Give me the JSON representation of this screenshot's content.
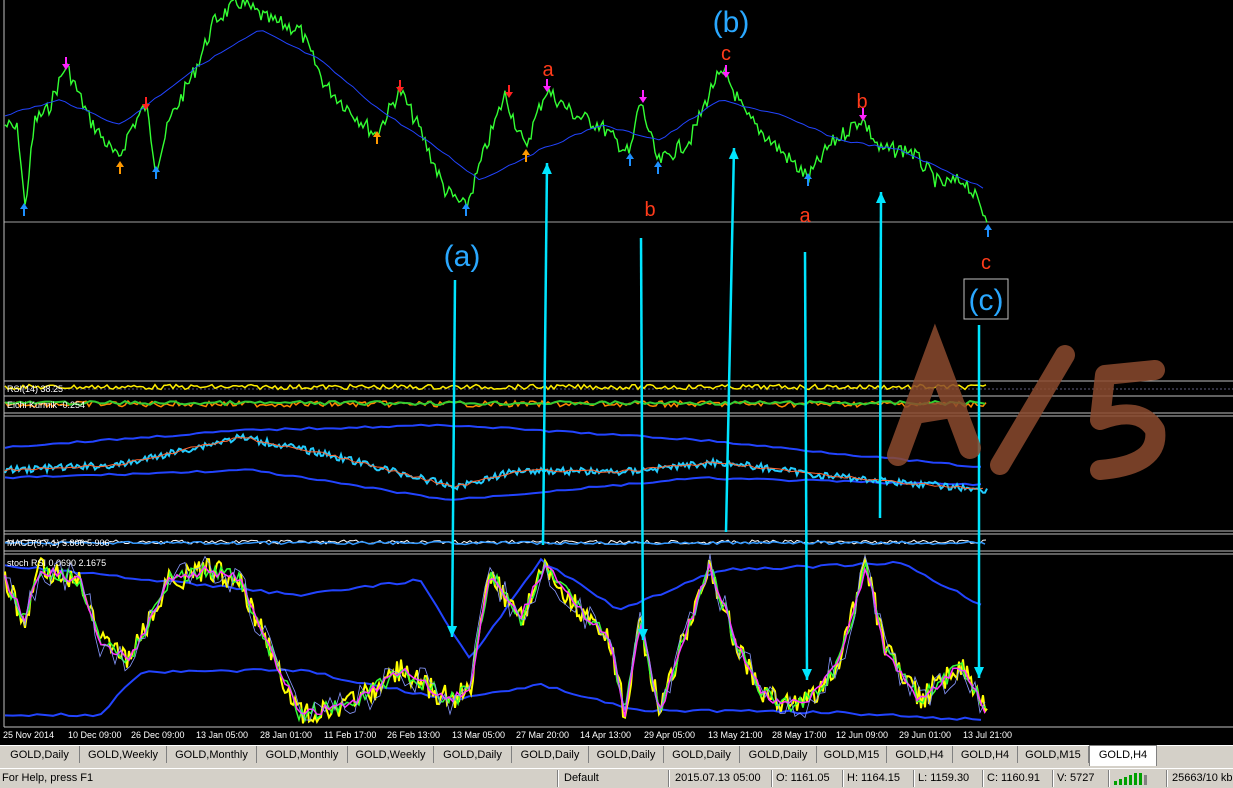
{
  "chart": {
    "dates": [
      "25 Nov 2014",
      "10 Dec 09:00",
      "26 Dec 09:00",
      "13 Jan 05:00",
      "28 Jan 01:00",
      "11 Feb 17:00",
      "26 Feb 13:00",
      "13 Mar 05:00",
      "27 Mar 20:00",
      "14 Apr 13:00",
      "29 Apr 05:00",
      "13 May 21:00",
      "28 May 17:00",
      "12 Jun 09:00",
      "29 Jun 01:00",
      "13 Jul 21:00"
    ],
    "wave_labels": {
      "a1": "a",
      "c1": "c",
      "b1": "b",
      "b2": "b",
      "a2": "a",
      "c2": "c",
      "big_b": "(b)",
      "big_a": "(a)",
      "big_c": "(c)"
    },
    "indicators": {
      "rsi_label": "RSI(14) 38.25",
      "ichimoku_label": "Eichi Kurmik -0.254",
      "macd_label": "MACD(9,7,1) 5.806 5.906",
      "stoch_label": "stoch RSI 0.0690 2.1675"
    },
    "watermark": "A / 5",
    "colors": {
      "price": "#33ff33",
      "ma": "#2244ff",
      "arrow_up": "#1e90ff",
      "arrow_magenta": "#ff22ff",
      "arrow_red": "#ff2020",
      "arrow_orange": "#ff9900",
      "wave_letter": "#ff3b1a",
      "wave_degree": "#2aa8ff",
      "guide_arrow": "#00e5ff",
      "watermark": "#8b4a2e"
    }
  },
  "tabs": [
    "GOLD,Daily",
    "GOLD,Weekly",
    "GOLD,Monthly",
    "GOLD,Monthly",
    "GOLD,Weekly",
    "GOLD,Daily",
    "GOLD,Daily",
    "GOLD,Daily",
    "GOLD,Daily",
    "GOLD,Daily",
    "GOLD,M15",
    "GOLD,H4",
    "GOLD,H4",
    "GOLD,M15",
    "GOLD,H4"
  ],
  "active_tab_index": 14,
  "status": {
    "help": "For Help, press F1",
    "profile": "Default",
    "datetime": "2015.07.13 05:00",
    "open": "O: 1161.05",
    "high": "H: 1164.15",
    "low": "L: 1159.30",
    "close": "C: 1160.91",
    "volume": "V: 5727",
    "traffic": "25663/10 kb"
  }
}
